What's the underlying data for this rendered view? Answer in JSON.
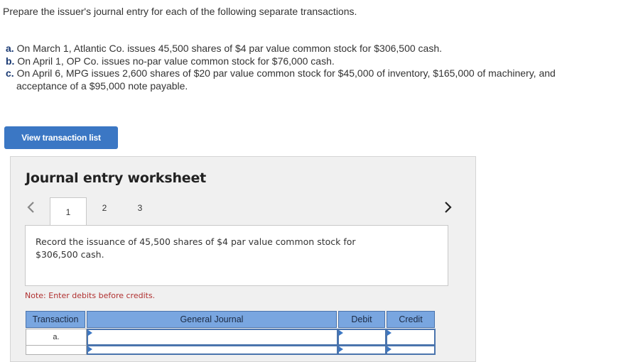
{
  "instructions": "Prepare the issuer's journal entry for each of the following separate transactions.",
  "transactions": [
    {
      "label": "a.",
      "text": "On March 1, Atlantic Co. issues 45,500 shares of $4 par value common stock for $306,500 cash."
    },
    {
      "label": "b.",
      "text": "On April 1, OP Co. issues no-par value common stock for $76,000 cash."
    },
    {
      "label": "c.",
      "text": "On April 6, MPG issues 2,600 shares of $20 par value common stock for $45,000 of inventory, $165,000 of machinery, and",
      "text_continued": "acceptance of a $95,000 note payable."
    }
  ],
  "view_button_label": "View transaction list",
  "worksheet": {
    "title": "Journal entry worksheet",
    "tabs": [
      "1",
      "2",
      "3"
    ],
    "active_tab": "1",
    "prompt_line1": "Record the issuance of 45,500 shares of $4 par value common stock for",
    "prompt_line2": "$306,500 cash.",
    "note": "Note: Enter debits before credits.",
    "table": {
      "headers": [
        "Transaction",
        "General Journal",
        "Debit",
        "Credit"
      ],
      "rows": [
        {
          "transaction": "a.",
          "account": "",
          "debit": "",
          "credit": ""
        },
        {
          "transaction": "",
          "account": "",
          "debit": "",
          "credit": ""
        }
      ]
    }
  },
  "colors": {
    "accent": "#3b77c4",
    "table_header": "#79a6e0",
    "note": "#b03030",
    "label": "#1a3a73"
  },
  "icons": {
    "prev": "chevron-left-icon",
    "next": "chevron-right-icon"
  }
}
